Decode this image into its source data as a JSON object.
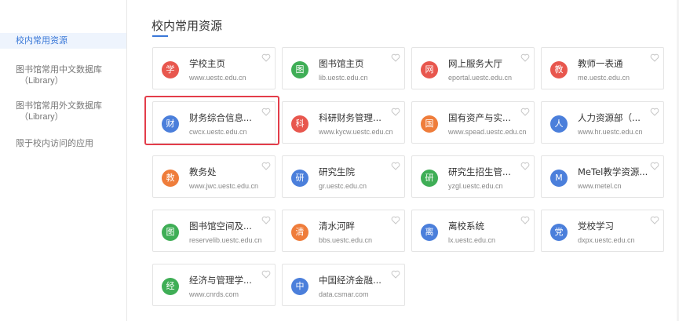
{
  "sidebar": {
    "items": [
      {
        "label": "校内常用资源",
        "sub": "",
        "active": true
      },
      {
        "label": "图书馆常用中文数据库",
        "sub": "（Library）",
        "active": false
      },
      {
        "label": "图书馆常用外文数据库",
        "sub": "（Library）",
        "active": false
      },
      {
        "label": "限于校内访问的应用",
        "sub": "",
        "active": false
      }
    ]
  },
  "main": {
    "title": "校内常用资源",
    "accent_color": "#3a78d8",
    "cards": [
      {
        "badge": "学",
        "name": "学校主页",
        "url": "www.uestc.edu.cn",
        "color": "#e8574e"
      },
      {
        "badge": "图",
        "name": "图书馆主页",
        "url": "lib.uestc.edu.cn",
        "color": "#3fae56"
      },
      {
        "badge": "网",
        "name": "网上服务大厅",
        "url": "eportal.uestc.edu.cn",
        "color": "#e8574e"
      },
      {
        "badge": "教",
        "name": "教师一表通",
        "url": "me.uestc.edu.cn",
        "color": "#e8574e"
      },
      {
        "badge": "财",
        "name": "财务综合信息...",
        "url": "cwcx.uestc.edu.cn",
        "color": "#4b7fdb"
      },
      {
        "badge": "科",
        "name": "科研财务管理...",
        "url": "www.kycw.uestc.edu.cn",
        "color": "#e8574e"
      },
      {
        "badge": "国",
        "name": "国有资产与实...",
        "url": "www.spead.uestc.edu.cn",
        "color": "#ef7d3b"
      },
      {
        "badge": "人",
        "name": "人力资源部（...",
        "url": "www.hr.uestc.edu.cn",
        "color": "#4b7fdb"
      },
      {
        "badge": "教",
        "name": "教务处",
        "url": "www.jwc.uestc.edu.cn",
        "color": "#ef7d3b"
      },
      {
        "badge": "研",
        "name": "研究生院",
        "url": "gr.uestc.edu.cn",
        "color": "#4b7fdb"
      },
      {
        "badge": "研",
        "name": "研究生招生管...",
        "url": "yzgl.uestc.edu.cn",
        "color": "#3fae56"
      },
      {
        "badge": "M",
        "name": "MeTel教学资源...",
        "url": "www.metel.cn",
        "color": "#4b7fdb"
      },
      {
        "badge": "图",
        "name": "图书馆空间及...",
        "url": "reservelib.uestc.edu.cn",
        "color": "#3fae56"
      },
      {
        "badge": "清",
        "name": "清水河畔",
        "url": "bbs.uestc.edu.cn",
        "color": "#ef7d3b"
      },
      {
        "badge": "离",
        "name": "离校系统",
        "url": "lx.uestc.edu.cn",
        "color": "#4b7fdb"
      },
      {
        "badge": "党",
        "name": "党校学习",
        "url": "dxpx.uestc.edu.cn",
        "color": "#4b7fdb"
      },
      {
        "badge": "经",
        "name": "经济与管理学...",
        "url": "www.cnrds.com",
        "color": "#3fae56"
      },
      {
        "badge": "中",
        "name": "中国经济金融...",
        "url": "data.csmar.com",
        "color": "#4b7fdb"
      }
    ],
    "highlight_color": "#e33d4a"
  }
}
